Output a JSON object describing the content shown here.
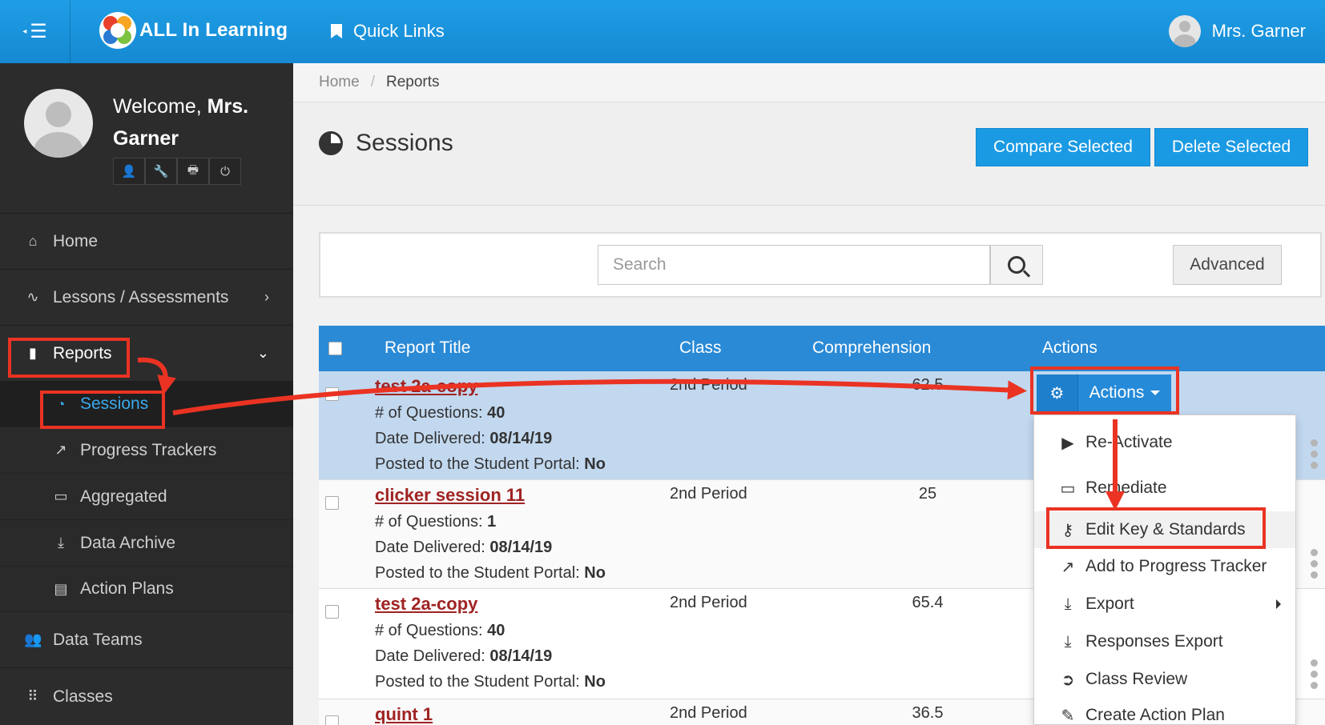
{
  "topbar": {
    "brand": "ALL In Learning",
    "quick_links": "Quick Links",
    "user_name": "Mrs. Garner"
  },
  "sidebar": {
    "welcome_prefix": "Welcome,",
    "welcome_name": "Mrs. Garner",
    "items": [
      {
        "label": "Home",
        "icon": "home-icon"
      },
      {
        "label": "Lessons / Assessments",
        "icon": "pulse-icon"
      },
      {
        "label": "Reports",
        "icon": "bar-chart-icon"
      }
    ],
    "sub_items": [
      {
        "label": "Sessions",
        "icon": "pie-chart-icon",
        "active": true
      },
      {
        "label": "Progress Trackers",
        "icon": "line-chart-icon"
      },
      {
        "label": "Aggregated",
        "icon": "inbox-icon"
      },
      {
        "label": "Data Archive",
        "icon": "download-icon"
      },
      {
        "label": "Action Plans",
        "icon": "clipboard-icon"
      }
    ],
    "bottom_items": [
      {
        "label": "Data Teams",
        "icon": "users-icon"
      },
      {
        "label": "Classes",
        "icon": "grid-icon"
      }
    ]
  },
  "breadcrumb": {
    "home": "Home",
    "sep": "/",
    "current": "Reports"
  },
  "page": {
    "title": "Sessions",
    "compare_btn": "Compare Selected",
    "delete_btn": "Delete Selected"
  },
  "search": {
    "placeholder": "Search",
    "advanced": "Advanced"
  },
  "table": {
    "headers": {
      "title": "Report Title",
      "class": "Class",
      "comprehension": "Comprehension",
      "actions": "Actions"
    },
    "labels": {
      "questions": "# of Questions:",
      "delivered": "Date Delivered:",
      "posted": "Posted to the Student Portal:"
    },
    "rows": [
      {
        "title": "test 2a-copy",
        "class": "2nd Period",
        "comprehension": "62.5",
        "questions": "40",
        "delivered": "08/14/19",
        "posted": "No"
      },
      {
        "title": "clicker session 11",
        "class": "2nd Period",
        "comprehension": "25",
        "questions": "1",
        "delivered": "08/14/19",
        "posted": "No"
      },
      {
        "title": "test 2a-copy",
        "class": "2nd Period",
        "comprehension": "65.4",
        "questions": "40",
        "delivered": "08/14/19",
        "posted": "No"
      },
      {
        "title": "quint 1",
        "class": "2nd Period",
        "comprehension": "36.5"
      }
    ]
  },
  "actions_menu": {
    "button": "Actions",
    "items": [
      {
        "label": "Re-Activate",
        "icon": "play-circle-icon"
      },
      {
        "label": "Remediate",
        "icon": "laptop-icon"
      },
      {
        "label": "Edit Key & Standards",
        "icon": "key-icon"
      },
      {
        "label": "Add to Progress Tracker",
        "icon": "line-chart-icon"
      },
      {
        "label": "Export",
        "icon": "download-icon"
      },
      {
        "label": "Responses Export",
        "icon": "download-icon"
      },
      {
        "label": "Class Review",
        "icon": "arrow-circle-icon"
      },
      {
        "label": "Create Action Plan",
        "icon": "edit-icon"
      }
    ]
  },
  "colors": {
    "accent": "#1b9ae4",
    "annotation": "#ea3323",
    "title_link": "#a02323",
    "sidebar": "#2c2c2c"
  }
}
